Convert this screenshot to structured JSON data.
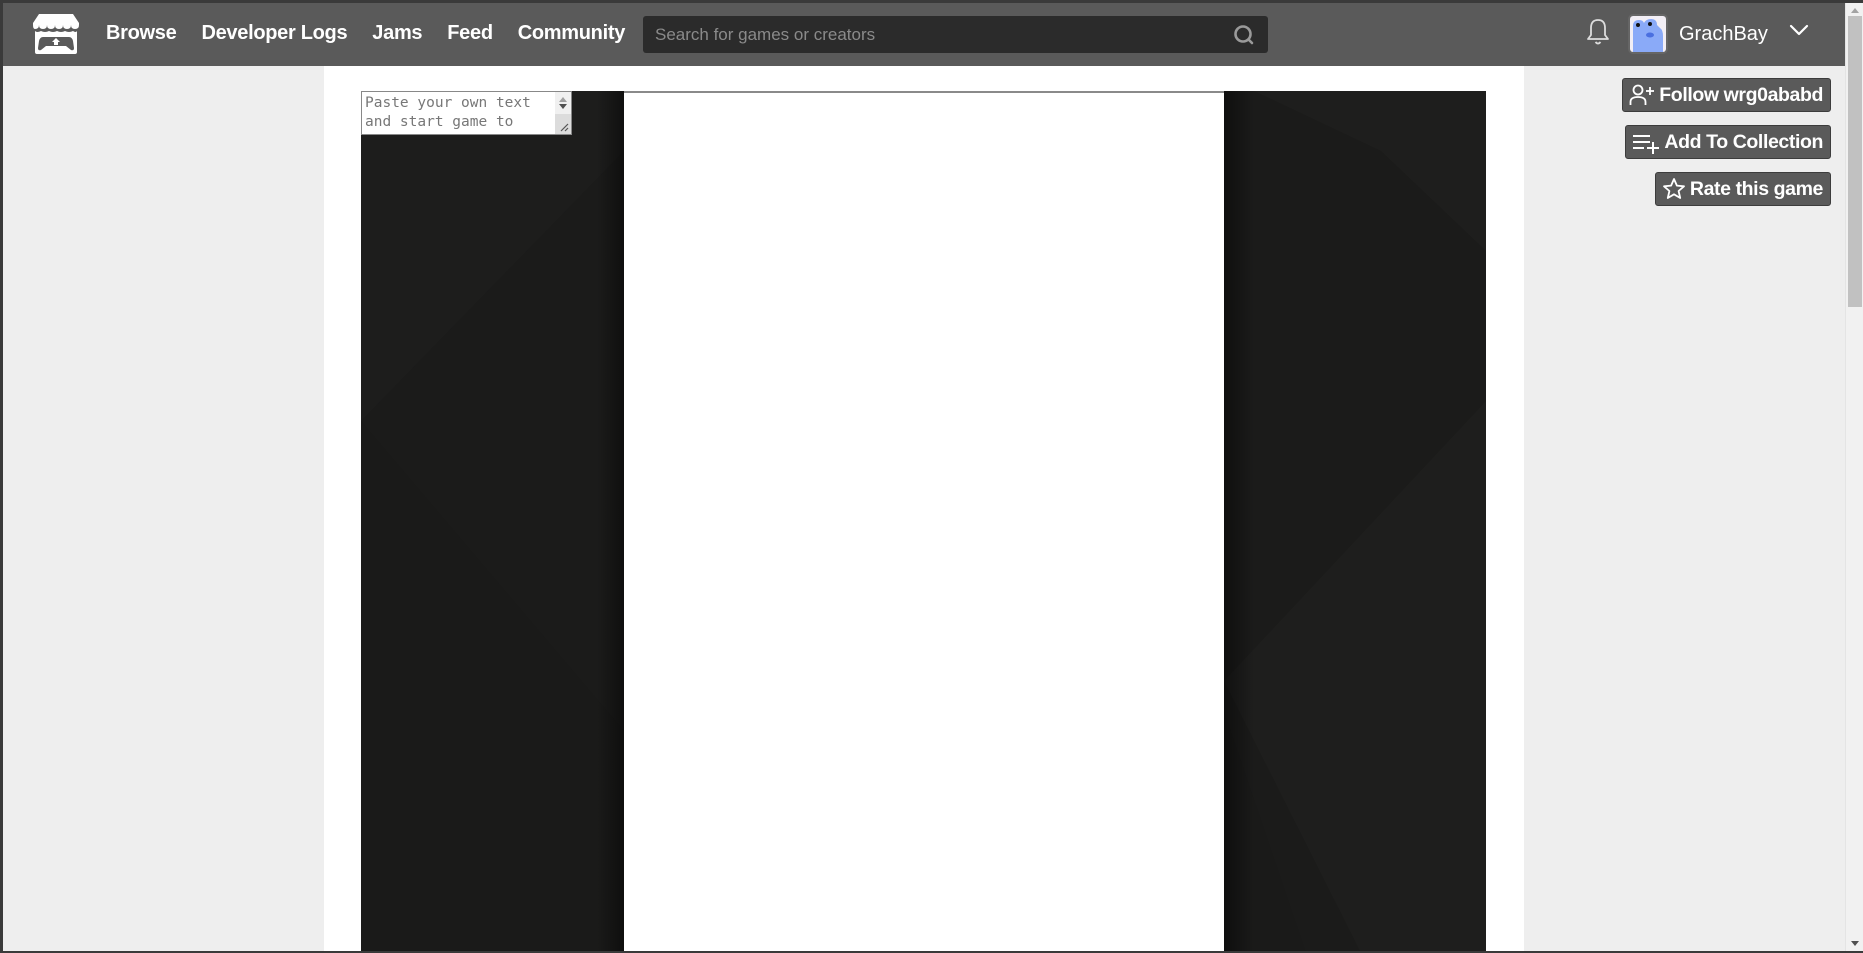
{
  "header": {
    "logo_icon": "itchio-storefront-icon",
    "nav": [
      {
        "label": "Browse"
      },
      {
        "label": "Developer Logs"
      },
      {
        "label": "Jams"
      },
      {
        "label": "Feed"
      },
      {
        "label": "Community"
      }
    ],
    "search": {
      "placeholder": "Search for games or creators",
      "value": "",
      "icon": "search-icon"
    },
    "notifications_icon": "bell-icon",
    "user": {
      "name": "GrachBay",
      "avatar": "frog-avatar",
      "menu_icon": "chevron-down-icon"
    }
  },
  "game": {
    "text_input": {
      "value": "Paste your own text\nand start game to",
      "placeholder": "Paste your own text and start game to"
    }
  },
  "actions": {
    "follow_label": "Follow wrg0ababd",
    "collection_label": "Add To Collection",
    "rate_label": "Rate this game"
  },
  "colors": {
    "header_bg": "#5a5a5a",
    "search_bg": "#2b2b2b",
    "page_bg": "#eeeeee",
    "game_bg": "#1b1b1a",
    "button_bg": "#5a5a5a"
  }
}
